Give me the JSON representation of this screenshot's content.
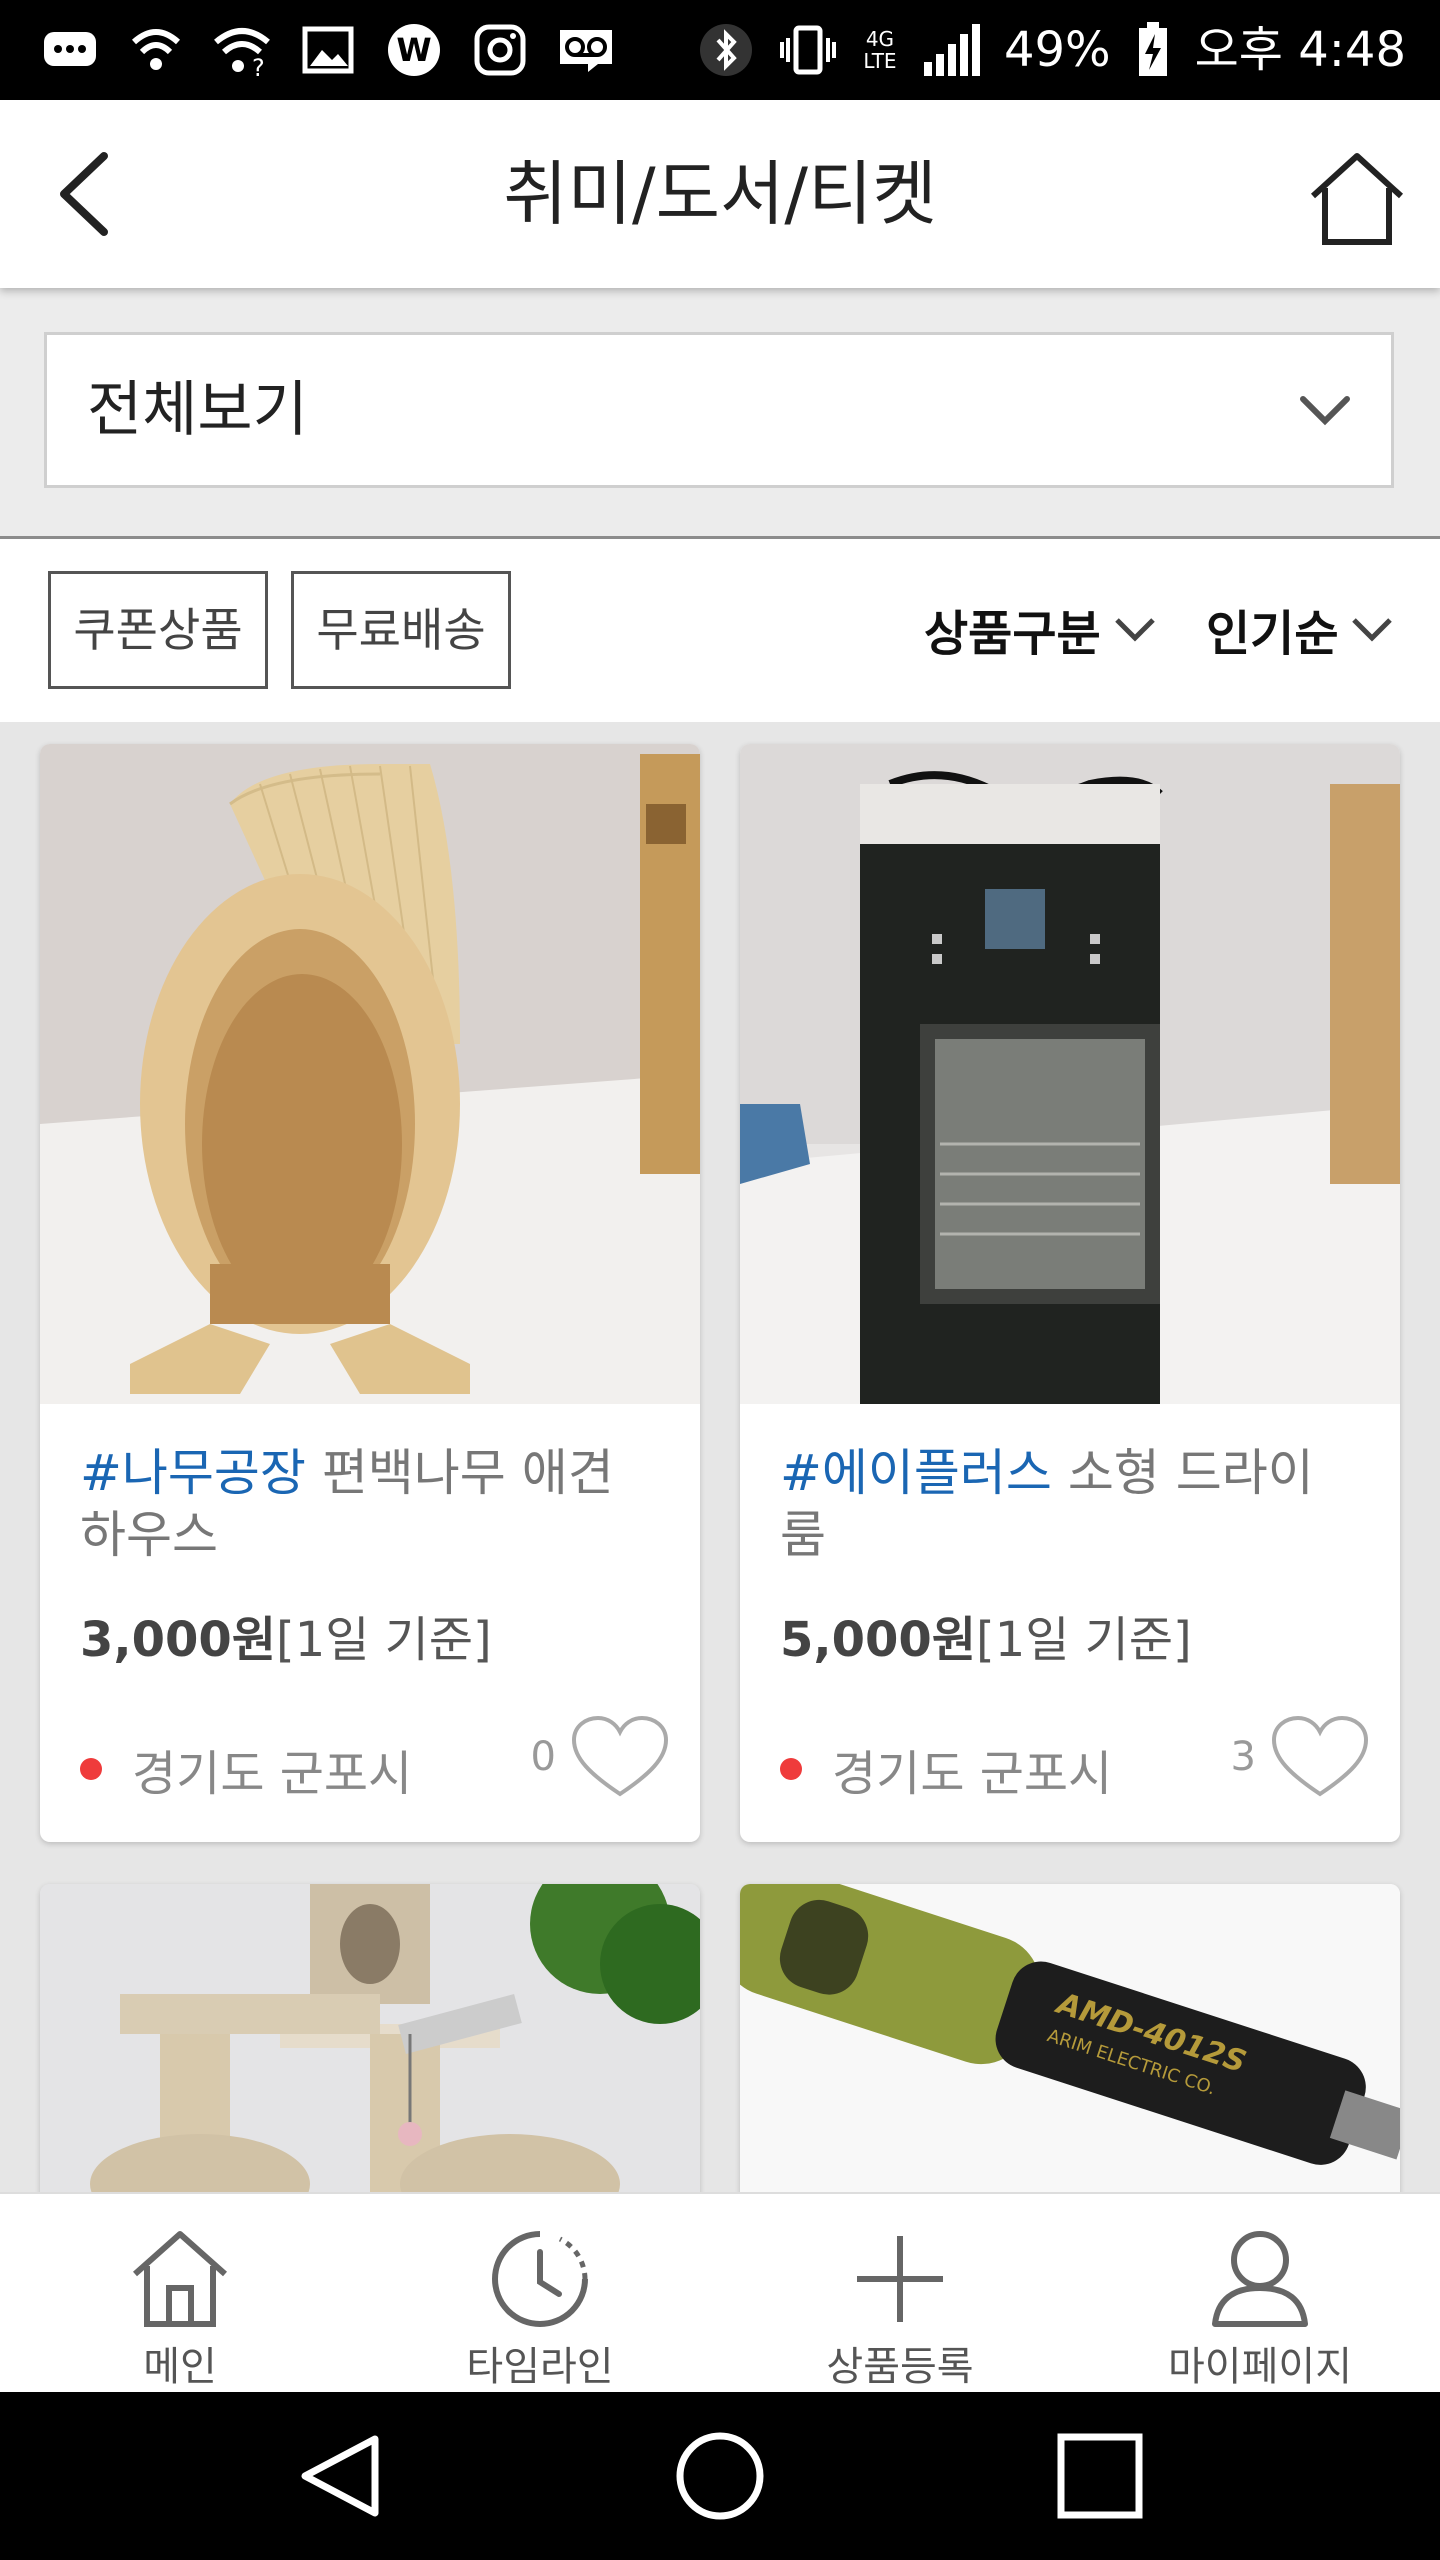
{
  "status_bar": {
    "battery_percent": "49%",
    "time": "오후 4:48",
    "network": "4G LTE",
    "icons_left": [
      "messenger-icon",
      "wifi-calling-icon",
      "wifi-question-icon",
      "gallery-icon",
      "w-app-icon",
      "instagram-icon",
      "voicemail-icon"
    ],
    "icons_right": [
      "bluetooth-icon",
      "vibrate-icon",
      "signal-icon",
      "battery-charging-icon"
    ]
  },
  "header": {
    "title": "취미/도서/티켓",
    "back_icon": "chevron-left-icon",
    "home_icon": "home-icon"
  },
  "category_select": {
    "selected": "전체보기"
  },
  "filters": {
    "chips": [
      "쿠폰상품",
      "무료배송"
    ],
    "sort_category": "상품구분",
    "sort_order": "인기순"
  },
  "products": [
    {
      "tag": "#나무공장",
      "name": "편백나무 애견하우스",
      "price": "3,000원",
      "price_unit": "[1일 기준]",
      "location": "경기도 군포시",
      "likes": "0"
    },
    {
      "tag": "#에이플러스",
      "name": "소형 드라이룸",
      "price": "5,000원",
      "price_unit": "[1일 기준]",
      "location": "경기도 군포시",
      "likes": "3"
    }
  ],
  "bottom_nav": [
    {
      "label": "메인",
      "icon": "home-icon"
    },
    {
      "label": "타임라인",
      "icon": "timeline-clock-icon"
    },
    {
      "label": "상품등록",
      "icon": "plus-icon"
    },
    {
      "label": "마이페이지",
      "icon": "user-icon"
    }
  ],
  "colors": {
    "tag_blue": "#1a66b3",
    "location_dot": "#ef3b3b",
    "background": "#e6e6e6"
  }
}
